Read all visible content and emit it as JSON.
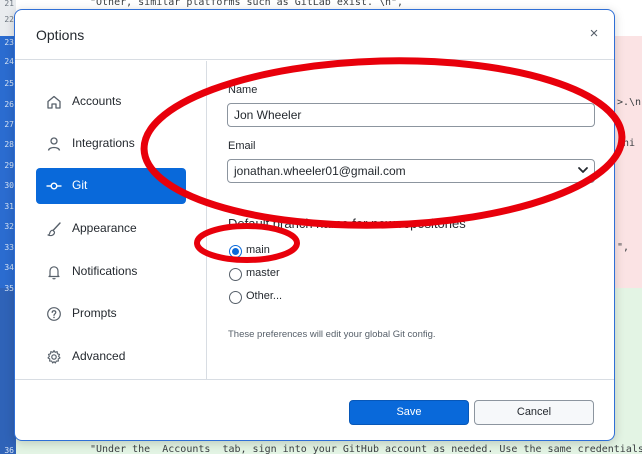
{
  "editor": {
    "line_numbers": [
      "21",
      "22",
      "23",
      "24",
      "25",
      "26",
      "27",
      "28",
      "29",
      "30",
      "31",
      "32",
      "33",
      "34",
      "35",
      "36"
    ],
    "line_21_text": "\"Other, similar platforms such as GitLab exist. \\n\",",
    "line_36_text": "\"Under the  Accounts  tab, sign into your GitHub account as needed. Use the same credentials",
    "snippet_right_1": ">.\\n",
    "snippet_right_2": "ini",
    "snippet_right_3": "\","
  },
  "dialog": {
    "title": "Options",
    "close_symbol": "×"
  },
  "sidebar": {
    "items": [
      {
        "label": "Accounts",
        "icon": "home-icon"
      },
      {
        "label": "Integrations",
        "icon": "person-icon"
      },
      {
        "label": "Git",
        "icon": "git-commit-icon",
        "active": true
      },
      {
        "label": "Appearance",
        "icon": "paintbrush-icon"
      },
      {
        "label": "Notifications",
        "icon": "bell-icon"
      },
      {
        "label": "Prompts",
        "icon": "question-icon"
      },
      {
        "label": "Advanced",
        "icon": "gear-icon"
      }
    ]
  },
  "git": {
    "name_label": "Name",
    "name_value": "Jon Wheeler",
    "email_label": "Email",
    "email_value": "jonathan.wheeler01@gmail.com",
    "branch_heading": "Default branch name for new repositories",
    "branch_options": [
      {
        "label": "main",
        "checked": true
      },
      {
        "label": "master",
        "checked": false
      },
      {
        "label": "Other...",
        "checked": false
      }
    ],
    "note": "These preferences will edit your global Git config."
  },
  "footer": {
    "save_label": "Save",
    "cancel_label": "Cancel"
  },
  "colors": {
    "accent": "#0969da",
    "annotation": "#e8000b"
  }
}
